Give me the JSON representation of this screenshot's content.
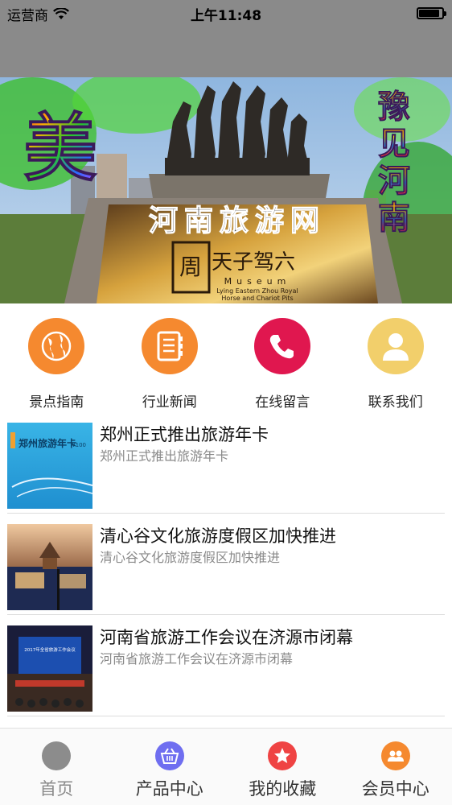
{
  "status": {
    "carrier": "运营商",
    "time": "上午11:48",
    "battery_level": 0.9
  },
  "banner": {
    "title": "河南旅游网",
    "left_char": "美",
    "right_text": "豫见河南",
    "plaque_text": "天子驾六",
    "museum_word": "Museum",
    "plaque_caption_1": "Lying Eastern Zhou Royal",
    "plaque_caption_2": "Horse and Chariot Pits"
  },
  "categories": [
    {
      "label": "景点指南",
      "icon": "globe-icon",
      "color": "#f5892f"
    },
    {
      "label": "行业新闻",
      "icon": "notebook-icon",
      "color": "#f5892f"
    },
    {
      "label": "在线留言",
      "icon": "phone-icon",
      "color": "#e0174f"
    },
    {
      "label": "联系我们",
      "icon": "contact-icon",
      "color": "#f2cf6b"
    }
  ],
  "news": [
    {
      "title": "郑州正式推出旅游年卡",
      "subtitle": "郑州正式推出旅游年卡",
      "thumb_text": "郑州旅游年卡",
      "thumb_price": "¥100"
    },
    {
      "title": "清心谷文化旅游度假区加快推进",
      "subtitle": "清心谷文化旅游度假区加快推进"
    },
    {
      "title": "河南省旅游工作会议在济源市闭幕",
      "subtitle": "河南省旅游工作会议在济源市闭幕",
      "thumb_text": "2017年全省旅游工作会议"
    }
  ],
  "tabs": [
    {
      "label": "首页",
      "icon": "home-icon",
      "color": "#8c8c8c"
    },
    {
      "label": "产品中心",
      "icon": "basket-icon",
      "color": "#6f6ef0"
    },
    {
      "label": "我的收藏",
      "icon": "star-icon",
      "color": "#ef4343"
    },
    {
      "label": "会员中心",
      "icon": "members-icon",
      "color": "#f5892f"
    }
  ]
}
